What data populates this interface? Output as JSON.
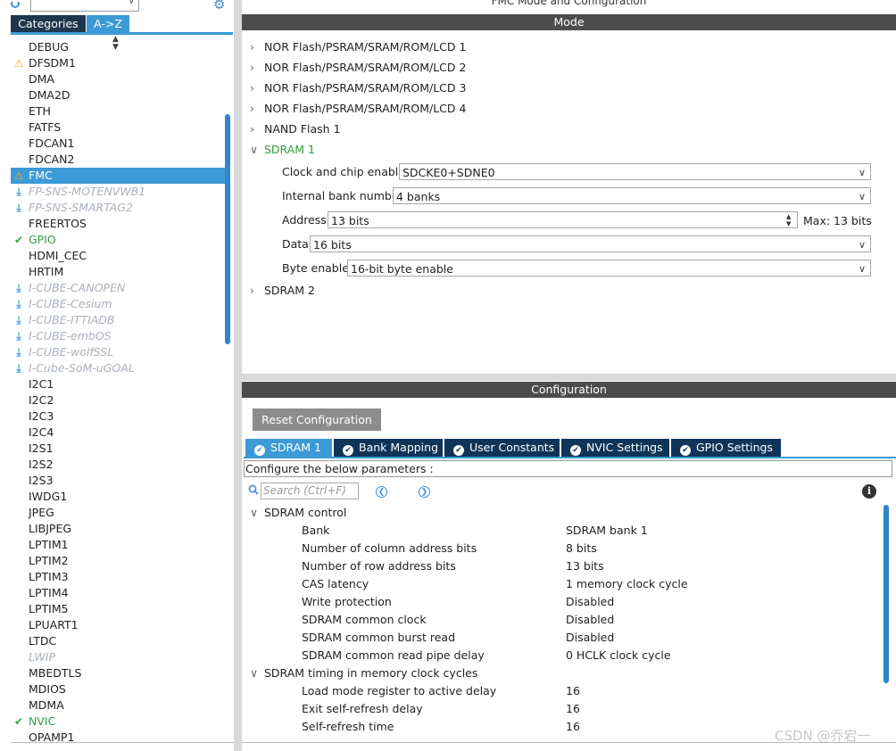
{
  "left_panel": {
    "tabs": {
      "categories": "Categories",
      "az": "A->Z"
    },
    "items": [
      {
        "label": "DEBUG",
        "status": "none"
      },
      {
        "label": "DFSDM1",
        "status": "warning"
      },
      {
        "label": "DMA",
        "status": "none"
      },
      {
        "label": "DMA2D",
        "status": "none"
      },
      {
        "label": "ETH",
        "status": "none"
      },
      {
        "label": "FATFS",
        "status": "none"
      },
      {
        "label": "FDCAN1",
        "status": "none"
      },
      {
        "label": "FDCAN2",
        "status": "none"
      },
      {
        "label": "FMC",
        "status": "warning-selected"
      },
      {
        "label": "FP-SNS-MOTENVWB1",
        "status": "download"
      },
      {
        "label": "FP-SNS-SMARTAG2",
        "status": "download"
      },
      {
        "label": "FREERTOS",
        "status": "none"
      },
      {
        "label": "GPIO",
        "status": "ok"
      },
      {
        "label": "HDMI_CEC",
        "status": "none"
      },
      {
        "label": "HRTIM",
        "status": "none"
      },
      {
        "label": "I-CUBE-CANOPEN",
        "status": "download"
      },
      {
        "label": "I-CUBE-Cesium",
        "status": "download"
      },
      {
        "label": "I-CUBE-ITTIADB",
        "status": "download"
      },
      {
        "label": "I-CUBE-embOS",
        "status": "download"
      },
      {
        "label": "I-CUBE-wolfSSL",
        "status": "download"
      },
      {
        "label": "I-Cube-SoM-uGOAL",
        "status": "download"
      },
      {
        "label": "I2C1",
        "status": "none"
      },
      {
        "label": "I2C2",
        "status": "none"
      },
      {
        "label": "I2C3",
        "status": "none"
      },
      {
        "label": "I2C4",
        "status": "none"
      },
      {
        "label": "I2S1",
        "status": "none"
      },
      {
        "label": "I2S2",
        "status": "none"
      },
      {
        "label": "I2S3",
        "status": "none"
      },
      {
        "label": "IWDG1",
        "status": "none"
      },
      {
        "label": "JPEG",
        "status": "none"
      },
      {
        "label": "LIBJPEG",
        "status": "none"
      },
      {
        "label": "LPTIM1",
        "status": "none"
      },
      {
        "label": "LPTIM2",
        "status": "none"
      },
      {
        "label": "LPTIM3",
        "status": "none"
      },
      {
        "label": "LPTIM4",
        "status": "none"
      },
      {
        "label": "LPTIM5",
        "status": "none"
      },
      {
        "label": "LPUART1",
        "status": "none"
      },
      {
        "label": "LTDC",
        "status": "none"
      },
      {
        "label": "LWIP",
        "status": "disabled"
      },
      {
        "label": "MBEDTLS",
        "status": "none"
      },
      {
        "label": "MDIOS",
        "status": "none"
      },
      {
        "label": "MDMA",
        "status": "none"
      },
      {
        "label": "NVIC",
        "status": "ok"
      },
      {
        "label": "OPAMP1",
        "status": "none"
      }
    ]
  },
  "header": {
    "title": "FMC Mode and Configuration"
  },
  "mode": {
    "bar_title": "Mode",
    "tree": [
      {
        "label": "NOR Flash/PSRAM/SRAM/ROM/LCD 1",
        "expanded": false
      },
      {
        "label": "NOR Flash/PSRAM/SRAM/ROM/LCD 2",
        "expanded": false
      },
      {
        "label": "NOR Flash/PSRAM/SRAM/ROM/LCD 3",
        "expanded": false
      },
      {
        "label": "NOR Flash/PSRAM/SRAM/ROM/LCD 4",
        "expanded": false
      },
      {
        "label": "NAND Flash 1",
        "expanded": false
      },
      {
        "label": "SDRAM 1",
        "expanded": true
      },
      {
        "label": "SDRAM 2",
        "expanded": false
      }
    ],
    "fields": {
      "clock_chip": {
        "label": "Clock and chip enable",
        "value": "SDCKE0+SDNE0"
      },
      "bank_number": {
        "label": "Internal bank number",
        "value": "4 banks"
      },
      "address": {
        "label": "Address",
        "value": "13 bits",
        "max": "Max: 13 bits"
      },
      "data": {
        "label": "Data",
        "value": "16 bits"
      },
      "byte_enable": {
        "label": "Byte enable",
        "value": "16-bit byte enable"
      }
    }
  },
  "config": {
    "bar_title": "Configuration",
    "reset_label": "Reset Configuration",
    "tabs": [
      {
        "label": "SDRAM 1",
        "active": true
      },
      {
        "label": "Bank Mapping",
        "active": false
      },
      {
        "label": "User Constants",
        "active": false
      },
      {
        "label": "NVIC Settings",
        "active": false
      },
      {
        "label": "GPIO Settings",
        "active": false
      }
    ],
    "params_header": "Configure the below parameters :",
    "search_placeholder": "Search (Ctrl+F)",
    "groups": [
      {
        "title": "SDRAM control",
        "params": [
          {
            "name": "Bank",
            "value": "SDRAM bank 1"
          },
          {
            "name": "Number of column address bits",
            "value": "8 bits"
          },
          {
            "name": "Number of row address bits",
            "value": "13 bits"
          },
          {
            "name": "CAS latency",
            "value": "1 memory clock cycle"
          },
          {
            "name": "Write protection",
            "value": "Disabled"
          },
          {
            "name": "SDRAM common clock",
            "value": "Disabled"
          },
          {
            "name": "SDRAM common burst read",
            "value": "Disabled"
          },
          {
            "name": "SDRAM common read pipe delay",
            "value": "0 HCLK clock cycle"
          }
        ]
      },
      {
        "title": "SDRAM timing in memory clock cycles",
        "params": [
          {
            "name": "Load mode register to active delay",
            "value": "16"
          },
          {
            "name": "Exit self-refresh delay",
            "value": "16"
          },
          {
            "name": "Self-refresh time",
            "value": "16"
          }
        ]
      }
    ]
  },
  "watermark": "CSDN @乔宕一",
  "colors": {
    "accent": "#3c9ad6",
    "dark_tab": "#0f3458",
    "bar": "#4c4c4c",
    "ok": "#2f9e44",
    "warning": "#f0b400"
  }
}
